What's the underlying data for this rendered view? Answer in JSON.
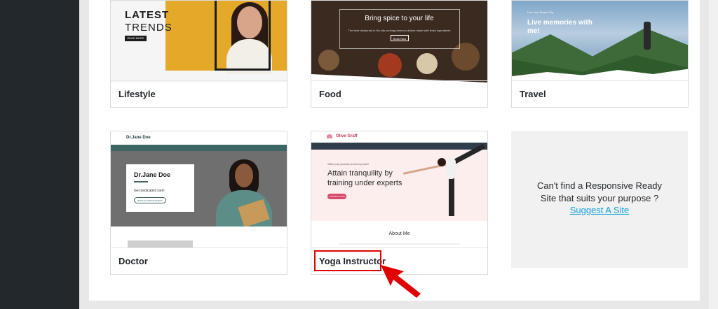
{
  "templates": [
    {
      "label": "Lifestyle",
      "preview": {
        "line1": "LATEST",
        "line2": "TRENDS",
        "button": "READ MORE"
      }
    },
    {
      "label": "Food",
      "preview": {
        "title": "Bring spice to your life",
        "subtitle": "The best restaurant in the city serving premium dishes made with fresh ingredients",
        "button": "Book Now"
      }
    },
    {
      "label": "Travel",
      "preview": {
        "small": "Live Your Dream Trip",
        "title": "Live memories with me!"
      }
    },
    {
      "label": "Doctor",
      "preview": {
        "logo": "Dr.Jane Doe",
        "name": "Dr.Jane Doe",
        "subtitle": "Get dedicated care!",
        "button": "BOOK AN APPOINTMENT"
      }
    },
    {
      "label": "Yoga Instructor",
      "preview": {
        "logo": "Olive Graff",
        "small": "Start your journey to inner peace!",
        "heading": "Attain tranquility by training under experts",
        "button": "CONTACT NOW",
        "about": "About Me"
      }
    }
  ],
  "suggest": {
    "text": "Can't find a Responsive Ready Site that suits your purpose ?",
    "link": "Suggest A Site"
  },
  "colors": {
    "highlight": "#e00000",
    "link": "#0fa0d8",
    "sidebar": "#23282d"
  }
}
